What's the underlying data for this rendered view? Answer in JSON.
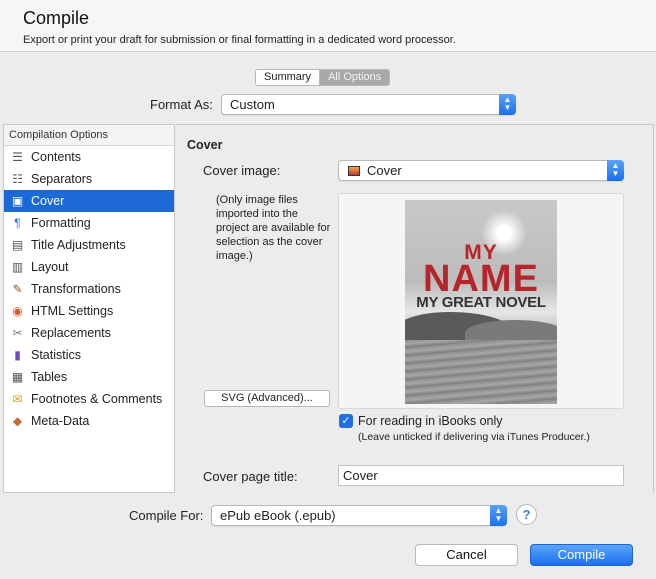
{
  "header": {
    "title": "Compile",
    "subtitle": "Export or print your draft for submission or final formatting in a dedicated word processor."
  },
  "mode_tabs": {
    "summary": "Summary",
    "all_options": "All Options",
    "selected": "All Options"
  },
  "format_as": {
    "label": "Format As:",
    "value": "Custom"
  },
  "sidebar": {
    "header": "Compilation Options",
    "selected": "Cover",
    "items": [
      {
        "label": "Contents",
        "icon": "contents-icon"
      },
      {
        "label": "Separators",
        "icon": "separators-icon"
      },
      {
        "label": "Cover",
        "icon": "cover-icon"
      },
      {
        "label": "Formatting",
        "icon": "formatting-icon"
      },
      {
        "label": "Title Adjustments",
        "icon": "title-adjustments-icon"
      },
      {
        "label": "Layout",
        "icon": "layout-icon"
      },
      {
        "label": "Transformations",
        "icon": "transformations-icon"
      },
      {
        "label": "HTML Settings",
        "icon": "html-settings-icon"
      },
      {
        "label": "Replacements",
        "icon": "replacements-icon"
      },
      {
        "label": "Statistics",
        "icon": "statistics-icon"
      },
      {
        "label": "Tables",
        "icon": "tables-icon"
      },
      {
        "label": "Footnotes & Comments",
        "icon": "footnotes-icon"
      },
      {
        "label": "Meta-Data",
        "icon": "meta-data-icon"
      }
    ]
  },
  "cover": {
    "section_title": "Cover",
    "cover_image_label": "Cover image:",
    "cover_image_value": "Cover",
    "note": "(Only image files imported into the project are available for selection as the cover image.)",
    "svg_button": "SVG (Advanced)...",
    "preview": {
      "line1": "MY",
      "line2": "NAME",
      "line3": "MY GREAT NOVEL"
    },
    "ibooks_checkbox": {
      "label": "For reading in iBooks only",
      "checked": true
    },
    "ibooks_note": "(Leave unticked if delivering via iTunes Producer.)",
    "cover_page_title_label": "Cover page title:",
    "cover_page_title_value": "Cover"
  },
  "compile_for": {
    "label": "Compile For:",
    "value": "ePub eBook (.epub)"
  },
  "help_label": "?",
  "buttons": {
    "cancel": "Cancel",
    "compile": "Compile"
  },
  "colors": {
    "accent": "#1b69d6",
    "title_red": "#b4262c"
  }
}
